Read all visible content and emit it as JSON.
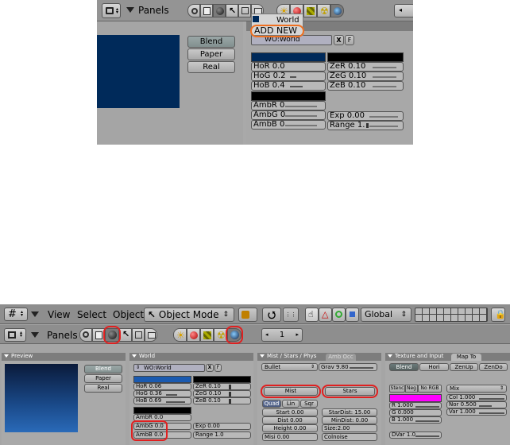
{
  "top": {
    "panels_label": "Panels",
    "menu": {
      "world_label": "World",
      "add_new_label": "ADD NEW"
    },
    "world_field": "WO:World",
    "x_label": "X",
    "f_label": "F",
    "mode_buttons": [
      "Blend",
      "Paper",
      "Real"
    ],
    "horizon": {
      "r": "HoR 0.0",
      "g": "HoG 0.2",
      "b": "HoB 0.4"
    },
    "zenith": {
      "r": "ZeR 0.10",
      "g": "ZeG 0.10",
      "b": "ZeB 0.10"
    },
    "ambient": {
      "r": "AmbR 0.",
      "g": "AmbG 0.",
      "b": "AmbB 0."
    },
    "exp": "Exp 0.00",
    "range": "Range 1.",
    "colors": {
      "preview": "#002a5a",
      "horizon": "#002a5a",
      "zenith": "#000000",
      "ambient": "#000000"
    }
  },
  "header": {
    "menus": [
      "View",
      "Select",
      "Object"
    ],
    "mode": "Object Mode",
    "orientation": "Global"
  },
  "buttons_header": {
    "panels_label": "Panels",
    "frame": "1"
  },
  "preview_panel": {
    "title": "Preview",
    "mode_buttons": [
      "Blend",
      "Paper",
      "Real"
    ]
  },
  "world_panel": {
    "title": "World",
    "world_field": "WO:World",
    "x_label": "X",
    "f_label": "F",
    "horizon": {
      "r": "HoR 0.06",
      "g": "HoG 0.36",
      "b": "HoB 0.69"
    },
    "zenith": {
      "r": "ZeR 0.10",
      "g": "ZeG 0.10",
      "b": "ZeB 0.10"
    },
    "ambient": {
      "r": "AmbR 0.0",
      "g": "AmbG 0.0",
      "b": "AmbB 0.0"
    },
    "exp": "Exp 0.00",
    "range": "Range 1.0",
    "colors": {
      "horizon": "#1a5ab0",
      "zenith": "#000000",
      "ambient": "#000000"
    }
  },
  "mist_panel": {
    "tab_title": "Mist / Stars / Phys",
    "tab_other": "Amb Occ",
    "physics": "Bullet",
    "grav": "Grav 9.80",
    "mist_label": "Mist",
    "stars_label": "Stars",
    "falloff": [
      "Quad",
      "Lin",
      "Sqr"
    ],
    "start": "Start 0.00",
    "dist": "Dist 0.00",
    "height": "Height 0.00",
    "misi": "Misi 0.00",
    "stardist": "StarDist: 15.00",
    "mindist": "MinDist: 0.00",
    "size": "Size:2.00",
    "colnoise": "Colnoise"
  },
  "texture_panel": {
    "tab_title": "Texture and Input",
    "tab_other": "Map To",
    "mapping": [
      "Blend",
      "Hori",
      "ZenUp",
      "ZenDo"
    ],
    "flags": [
      "Stenc",
      "Neg",
      "No RGB"
    ],
    "blend_mode": "Mix",
    "r": "R 1.000",
    "g": "G 0.000",
    "b": "B 1.000",
    "col": "Col 1.000",
    "nor": "Nor 0.500",
    "var": "Var 1.000",
    "dvar": "DVar 1.0",
    "color": "#ff00ff"
  }
}
